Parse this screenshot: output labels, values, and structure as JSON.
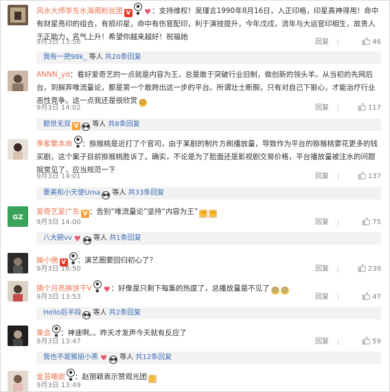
{
  "comments": [
    {
      "username": "风水大师李东水海南粉丝团",
      "text": "：支持维权！吴瑾言1990年8月16日，入正印格，印星真神得用！命中有财星亮印的组合，有损印星，命中有伤官配印，利于演技提升，今年戊戌，流年与大运官印相生，故贵人于正助力，名气上升！希望你越来越好！祝福她",
      "time": "9月3日 13:56",
      "reply": "回复",
      "likes": "46",
      "sub": {
        "name": "我有一把98k_",
        "rest": "等人",
        "link": "共20条回复"
      }
    },
    {
      "username": "ANNN_yd",
      "text": "：看好爱奇艺的一点就是内容为王，总是敢于突破行业旧制，做创新的领头羊。从当初的先网后台，到摒弃唯流量论，都是第一个敢跨出这一步的平台。所谓壮士断腕，只有对自己下狠心，才能治疗行业恶性竞争。这一点我还是很欣赏",
      "time": "9月3日 14:02",
      "reply": "回复",
      "likes": "117",
      "sub": {
        "name": "额世无双",
        "rest": "等人",
        "link": "共8条回复"
      }
    },
    {
      "username": "季紫繁本命",
      "text": "：猕猴桃是近打了个官司，由于某剧的制片方刷播放量，导致作为平台的猕猴桃要花更多的钱买剧，这个案子目前猕猴桃胜诉了。确实，不论是为了脸面还是影视剧交易价格，平台播放量被注水的问题挺常见了，应当规范一下",
      "time": "9月3日 14:01",
      "reply": "回复",
      "likes": "137",
      "sub": {
        "name": "要美和小天使Uma",
        "rest": "等人",
        "link": "共33条回复"
      }
    },
    {
      "username": "爱奇艺爱广东",
      "text": "：告别“唯流量论”坚持“内容为王”",
      "time": "9月3日 14:00",
      "reply": "回复",
      "likes": "75",
      "sub": {
        "name": "八大碗vv",
        "rest": "等人",
        "link": "共1条回复"
      }
    },
    {
      "username": "娱小佛",
      "text": "：演艺圈要回归初心了？",
      "time": "9月3日 16:50",
      "reply": "回复",
      "likes": "239",
      "sub": null
    },
    {
      "username": "摘个月亮换饼干V",
      "text": "：好像是只剩下每集的热度了，总播放量是不见了",
      "time": "9月3日 13:53",
      "reply": "回复",
      "likes": "47",
      "sub": {
        "name": "Hello后半段",
        "rest": "等人",
        "link": "共2条回复"
      }
    },
    {
      "username": "果会",
      "text": "：神速啊。。昨天才发声今天就有反应了",
      "time": "9月3日 13:47",
      "reply": "回复",
      "likes": "59",
      "sub": {
        "name": "我也不是猴丽小黑",
        "rest": "等人",
        "link": "共12条回复"
      }
    },
    {
      "username": "金苔曦妮",
      "text": "：赵丽颖表示赞观光团",
      "time": "9月3日 13:49",
      "reply": "回复",
      "likes": "",
      "sub": null
    }
  ],
  "colors": {
    "username": "#eb7350",
    "link": "#3a6bb5",
    "meta": "#808080",
    "subbg": "#f2f2f2"
  }
}
